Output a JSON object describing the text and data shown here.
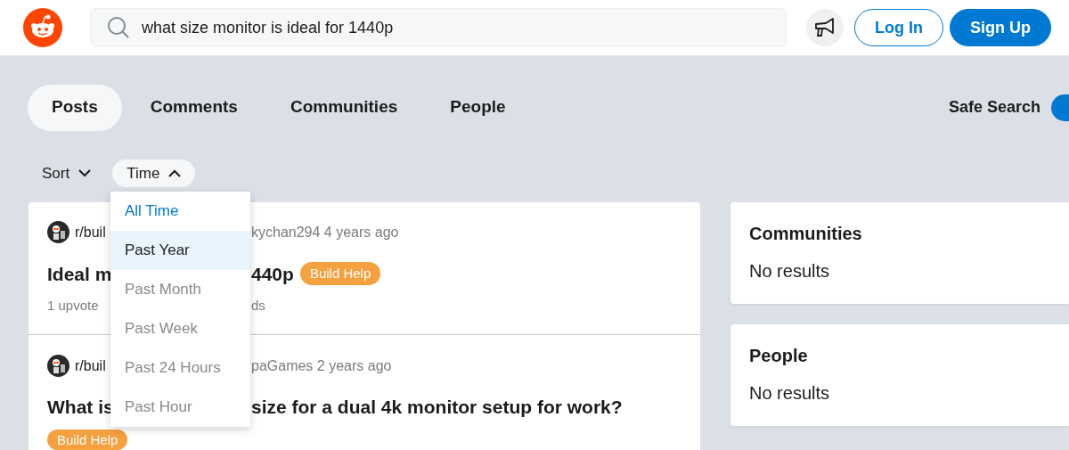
{
  "header": {
    "search": {
      "value": "what size monitor is ideal for 1440p"
    },
    "buttons": [
      {
        "label": "Log In",
        "kind": "outline"
      },
      {
        "label": "Sign Up",
        "kind": "solid"
      }
    ]
  },
  "tabs": [
    {
      "label": "Posts",
      "selected": true
    },
    {
      "label": "Comments",
      "selected": false
    },
    {
      "label": "Communities",
      "selected": false
    },
    {
      "label": "People",
      "selected": false
    }
  ],
  "safe_search": {
    "label": "Safe Search",
    "on": true
  },
  "filters": [
    {
      "label": "Sort",
      "expanded": false
    },
    {
      "label": "Time",
      "expanded": true
    }
  ],
  "time_menu": [
    {
      "label": "All Time",
      "selected": true,
      "highlighted": false
    },
    {
      "label": "Past Year",
      "selected": false,
      "highlighted": true
    },
    {
      "label": "Past Month",
      "selected": false,
      "highlighted": false
    },
    {
      "label": "Past Week",
      "selected": false,
      "highlighted": false
    },
    {
      "label": "Past 24 Hours",
      "selected": false,
      "highlighted": false
    },
    {
      "label": "Past Hour",
      "selected": false,
      "highlighted": false
    }
  ],
  "posts": [
    {
      "subreddit": "r/buil",
      "meta": "kychan294 4 years ago",
      "title_left": "Ideal m",
      "title_right": "440p",
      "flair": "Build Help",
      "flair_inline": true,
      "stats_left": "1 upvote",
      "stats_right": "ds"
    },
    {
      "subreddit": "r/buil",
      "meta": "paGames 2 years ago",
      "title_left": "What is",
      "title_right": "size for a dual 4k monitor setup for work?",
      "flair": "Build Help",
      "flair_inline": false
    }
  ],
  "side_cards": [
    {
      "title": "Communities",
      "text": "No results"
    },
    {
      "title": "People",
      "text": "No results"
    }
  ]
}
